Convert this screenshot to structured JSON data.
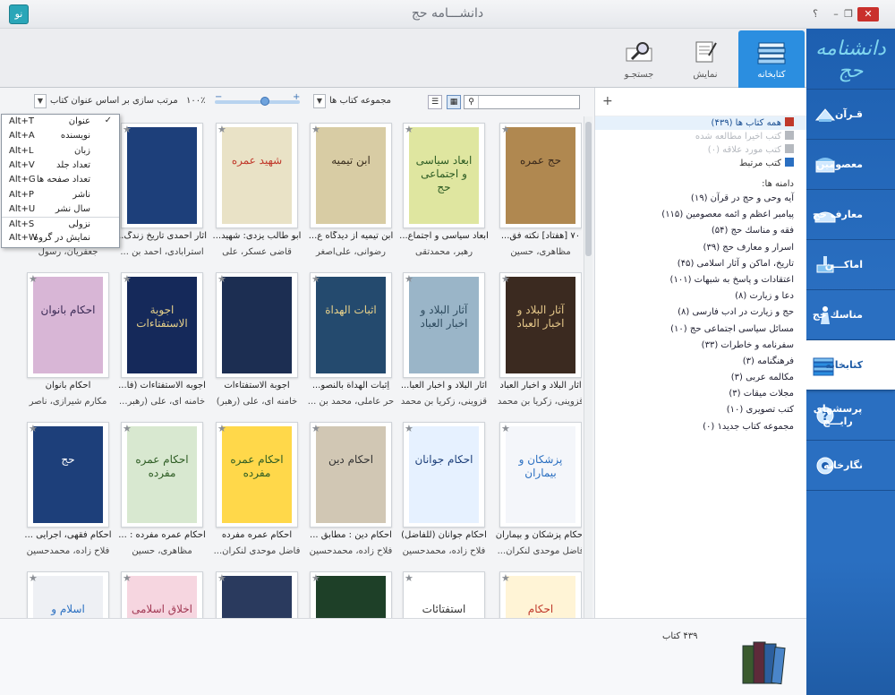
{
  "window": {
    "title": "دانشـــامه حج",
    "app_logo": "نو",
    "controls": {
      "help": "؟",
      "minimize": "–",
      "restore": "❐",
      "close": "✕"
    }
  },
  "sidenav": {
    "logo": "دانشنامه حج",
    "items": [
      {
        "label": "قـرآن",
        "icon": "quran-icon"
      },
      {
        "label": "معصومین",
        "icon": "shrine-icon"
      },
      {
        "label": "معارف حج",
        "icon": "teachings-icon"
      },
      {
        "label": "اماكـــن",
        "icon": "mosque-icon"
      },
      {
        "label": "مناسك حج",
        "icon": "pilgrim-icon"
      },
      {
        "label": "كتابخانه",
        "icon": "library-icon"
      },
      {
        "label": "پرسشهای رایـــج",
        "icon": "faq-icon"
      },
      {
        "label": "نگارخانه",
        "icon": "gallery-icon"
      }
    ]
  },
  "top_tabs": [
    {
      "label": "کتابخانه",
      "icon": "books-stack-icon"
    },
    {
      "label": "نمایش",
      "icon": "document-view-icon"
    },
    {
      "label": "جستجـو",
      "icon": "magnifier-icon"
    }
  ],
  "toolbar": {
    "sort_label": "مرتب سازی بر اساس عنوان كتاب",
    "zoom": "۱۰۰٪",
    "zoom_percent": 60,
    "collection_label": "مجموعه كتاب ها",
    "search_placeholder": ""
  },
  "sort_menu": [
    {
      "label": "عنوان",
      "key": "Alt+T",
      "checked": "✓"
    },
    {
      "label": "نویسنده",
      "key": "Alt+A",
      "checked": ""
    },
    {
      "label": "زبان",
      "key": "Alt+L",
      "checked": ""
    },
    {
      "label": "تعداد جلد",
      "key": "Alt+V",
      "checked": ""
    },
    {
      "label": "تعداد صفحه ها",
      "key": "Alt+G",
      "checked": ""
    },
    {
      "label": "ناشر",
      "key": "Alt+P",
      "checked": ""
    },
    {
      "label": "سال نشر",
      "key": "Alt+U",
      "checked": ""
    },
    {
      "label": "نزولی",
      "key": "Alt+S",
      "checked": ""
    },
    {
      "label": "نمایش در گروه",
      "key": "Alt+W",
      "checked": ""
    }
  ],
  "library_panel": {
    "add": "+",
    "top_items": [
      {
        "label": "همه كتاب ها (۴۳۹)",
        "state": "selected"
      },
      {
        "label": "كتب اخیرا مطالعه شده",
        "state": "dim"
      },
      {
        "label": "كتب مورد علاقه (۰)",
        "state": "dim"
      },
      {
        "label": "كتب مرتبط",
        "state": "normal"
      }
    ],
    "categories_title": "دامنه ها:",
    "categories": [
      "آیه وحی و حج در قرآن (۱۹)",
      "پیامبر اعظم و ائمه معصومین (۱۱۵)",
      "فقه و مناسك حج (۵۴)",
      "اسرار و معارف حج (۳۹)",
      "تاریخ، اماكن و آثار اسلامی (۴۵)",
      "اعتقادات و پاسخ به شبهات (۱۰۱)",
      "دعا و زیارت (۸)",
      "حج و زیارت در ادب فارسی (۸)",
      "مسائل سیاسی اجتماعی حج (۱۰)",
      "سفرنامه و خاطرات (۳۳)",
      "فرهنگنامه (۳)",
      "مكالمه عربی (۳)",
      "مجلات میقات (۳)",
      "كتب تصویری (۱۰)",
      "مجموعه كتاب جدید۱ (۰)"
    ]
  },
  "books": [
    {
      "title": "۷۰ [هفتاد] نكته فق...",
      "author": "مظاهری، حسین",
      "cover": "حج عمره"
    },
    {
      "title": "ابعاد سیاسی و اجتماع...",
      "author": "رهبر، محمدتقی",
      "cover": "ابعاد سیاسی و اجتماعی حج"
    },
    {
      "title": "ابن تیمیه از دیدگاه ع...",
      "author": "رضوانی، علی‌اصغر",
      "cover": "ابن تیمیه"
    },
    {
      "title": "ابو طالب یزدی: شهید...",
      "author": "قاضی عسکر، علی",
      "cover": "شهید عمره"
    },
    {
      "title": "آثار احمدی تاریخ زندگ...",
      "author": "استرآبادی، احمد بن ...",
      "cover": ""
    },
    {
      "title": "",
      "author": "جعفریان، رسول",
      "cover": ""
    },
    {
      "title": "آثار البلاد و اخبار العباد",
      "author": "قزوینی، زكریا بن محمد",
      "cover": "آثار البلاد و اخبار العباد"
    },
    {
      "title": "آثار البلاد و اخبار العبا...",
      "author": "قزوینی، زكریا بن محمد",
      "cover": "آثار البلاد و اخبار العباد"
    },
    {
      "title": "اِثبات الهداة بالنصو...",
      "author": "حر عاملی، محمد بن ...",
      "cover": "اثبات الهداة"
    },
    {
      "title": "اجوبة الاستفتاءات",
      "author": "خامنه ای، علی (رهبر)",
      "cover": ""
    },
    {
      "title": "اجوبه الاستفتاءات (فا...",
      "author": "خامنه ای، علی (رهبر...",
      "cover": "اجوبة الاستفتاءات"
    },
    {
      "title": "احكام بانوان",
      "author": "مكارم شیرازی، ناصر",
      "cover": "احكام بانوان"
    },
    {
      "title": "احكام پزشكان و بیماران",
      "author": "فاضل موحدی لنكران...",
      "cover": "پزشکان و بیماران"
    },
    {
      "title": "احكام جوانان (للفاضل)",
      "author": "فلاح زاده، محمدحسین",
      "cover": "احكام جوانان"
    },
    {
      "title": "احكام دین : مطابق ...",
      "author": "فلاح زاده، محمدحسین",
      "cover": "احكام دین"
    },
    {
      "title": "احكام عمره مفرده",
      "author": "فاضل موحدی لنكران...",
      "cover": "احكام عمره مفرده"
    },
    {
      "title": "احكام عمره مفرده : ...",
      "author": "مظاهری، حسین",
      "cover": "احكام عمره مفرده"
    },
    {
      "title": "احكام فقهی، اجرایی ...",
      "author": "فلاح زاده، محمدحسین",
      "cover": "حج"
    },
    {
      "title": "",
      "author": "",
      "cover": "احكام نوجوانان"
    },
    {
      "title": "",
      "author": "",
      "cover": "استفتائات"
    },
    {
      "title": "",
      "author": "",
      "cover": ""
    },
    {
      "title": "",
      "author": "",
      "cover": ""
    },
    {
      "title": "",
      "author": "",
      "cover": "اخلاق اسلامی"
    },
    {
      "title": "",
      "author": "",
      "cover": "اسلام و تربیت"
    }
  ],
  "status": {
    "count": "۴۳۹ كتاب"
  },
  "colors": {
    "nav_blue": "#2a6fc1",
    "tab_active": "#2b8ee0",
    "selection": "#e6f1fb"
  }
}
